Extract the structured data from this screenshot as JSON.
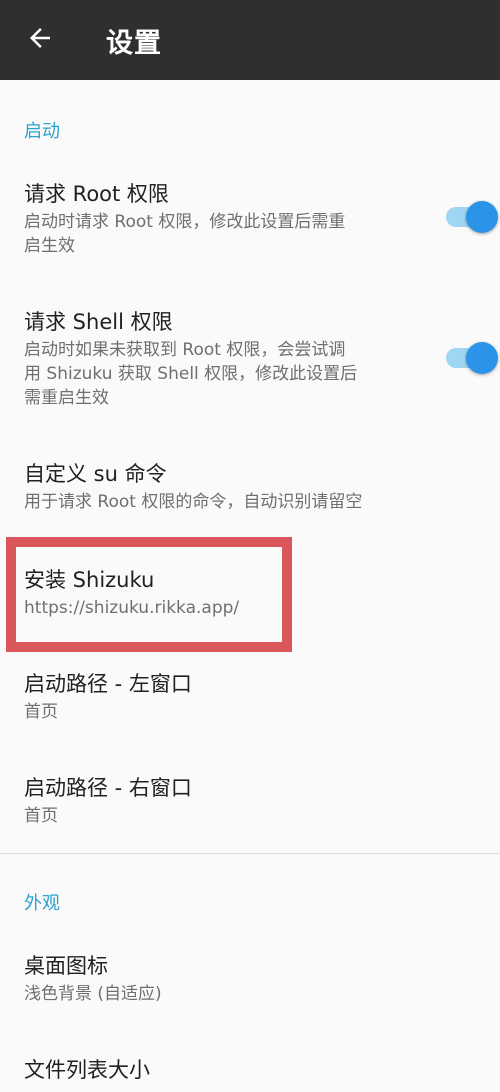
{
  "appbar": {
    "title": "设置",
    "back_icon": "arrow-back-icon"
  },
  "sections": {
    "startup": {
      "title": "启动"
    },
    "appearance": {
      "title": "外观"
    }
  },
  "items": {
    "root": {
      "title": "请求 Root 权限",
      "summary_lines": [
        "启动时请求 Root 权限，修改此设置后需重",
        "启生效"
      ],
      "enabled": true
    },
    "shell": {
      "title": "请求 Shell 权限",
      "summary_lines": [
        "启动时如果未获取到 Root 权限，会尝试调",
        "用 Shizuku 获取 Shell 权限，修改此设置后",
        "需重启生效"
      ],
      "enabled": true
    },
    "su": {
      "title": "自定义 su 命令",
      "summary": "用于请求 Root 权限的命令，自动识别请留空"
    },
    "shizuku": {
      "title": "安装 Shizuku",
      "summary": "https://shizuku.rikka.app/"
    },
    "left_path": {
      "title": "启动路径 - 左窗口",
      "summary": "首页"
    },
    "right_path": {
      "title": "启动路径 - 右窗口",
      "summary": "首页"
    },
    "desktop_icon": {
      "title": "桌面图标",
      "summary": "浅色背景 (自适应)"
    },
    "file_list_size": {
      "title": "文件列表大小"
    }
  },
  "colors": {
    "accent": "#2aa3cf",
    "switch_thumb": "#2b93e8",
    "switch_track": "#9fd6f3",
    "highlight_box": "#d9575a",
    "appbar": "#2f2f2f"
  }
}
